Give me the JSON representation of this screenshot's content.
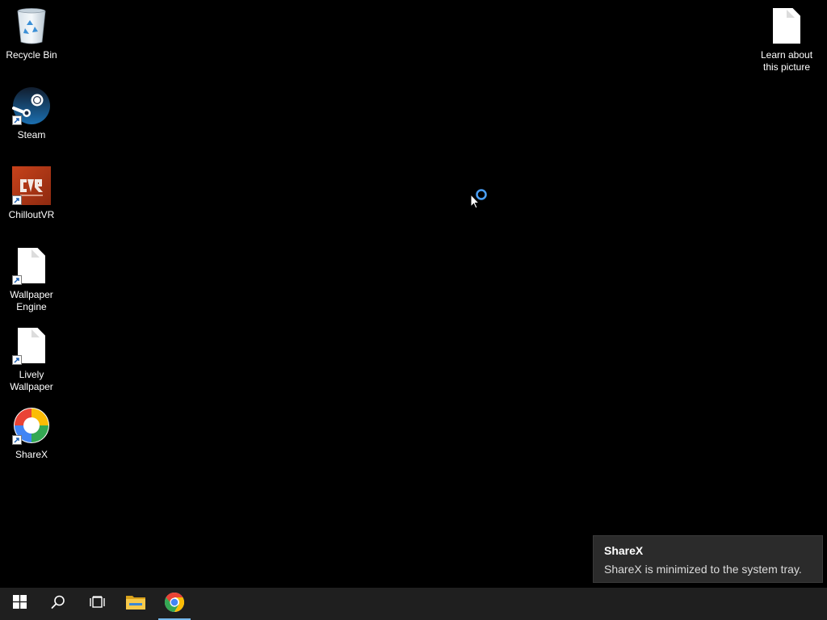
{
  "desktop": {
    "icons": [
      {
        "label": "Recycle Bin",
        "icon": "recycle-bin-icon"
      },
      {
        "label": "Steam",
        "icon": "steam-icon"
      },
      {
        "label": "ChilloutVR",
        "icon": "chilloutvr-icon"
      },
      {
        "label": "Wallpaper\nEngine",
        "icon": "file-icon"
      },
      {
        "label": "Lively\nWallpaper",
        "icon": "file-icon"
      },
      {
        "label": "ShareX",
        "icon": "sharex-icon"
      }
    ],
    "right_icon": {
      "label": "Learn about\nthis picture",
      "icon": "file-icon"
    }
  },
  "toast": {
    "title": "ShareX",
    "body": "ShareX is minimized to the system tray."
  },
  "taskbar": {
    "items": [
      {
        "icon": "windows-start-icon"
      },
      {
        "icon": "search-icon"
      },
      {
        "icon": "task-view-icon"
      },
      {
        "icon": "folder-icon"
      },
      {
        "icon": "chrome-icon",
        "active": true
      }
    ]
  },
  "colors": {
    "desktop_bg": "#000000",
    "taskbar_bg": "#1f1f1f",
    "toast_bg": "#2b2b2b",
    "active_indicator": "#76b9ed",
    "cursor_ring": "#4a9ff5"
  }
}
